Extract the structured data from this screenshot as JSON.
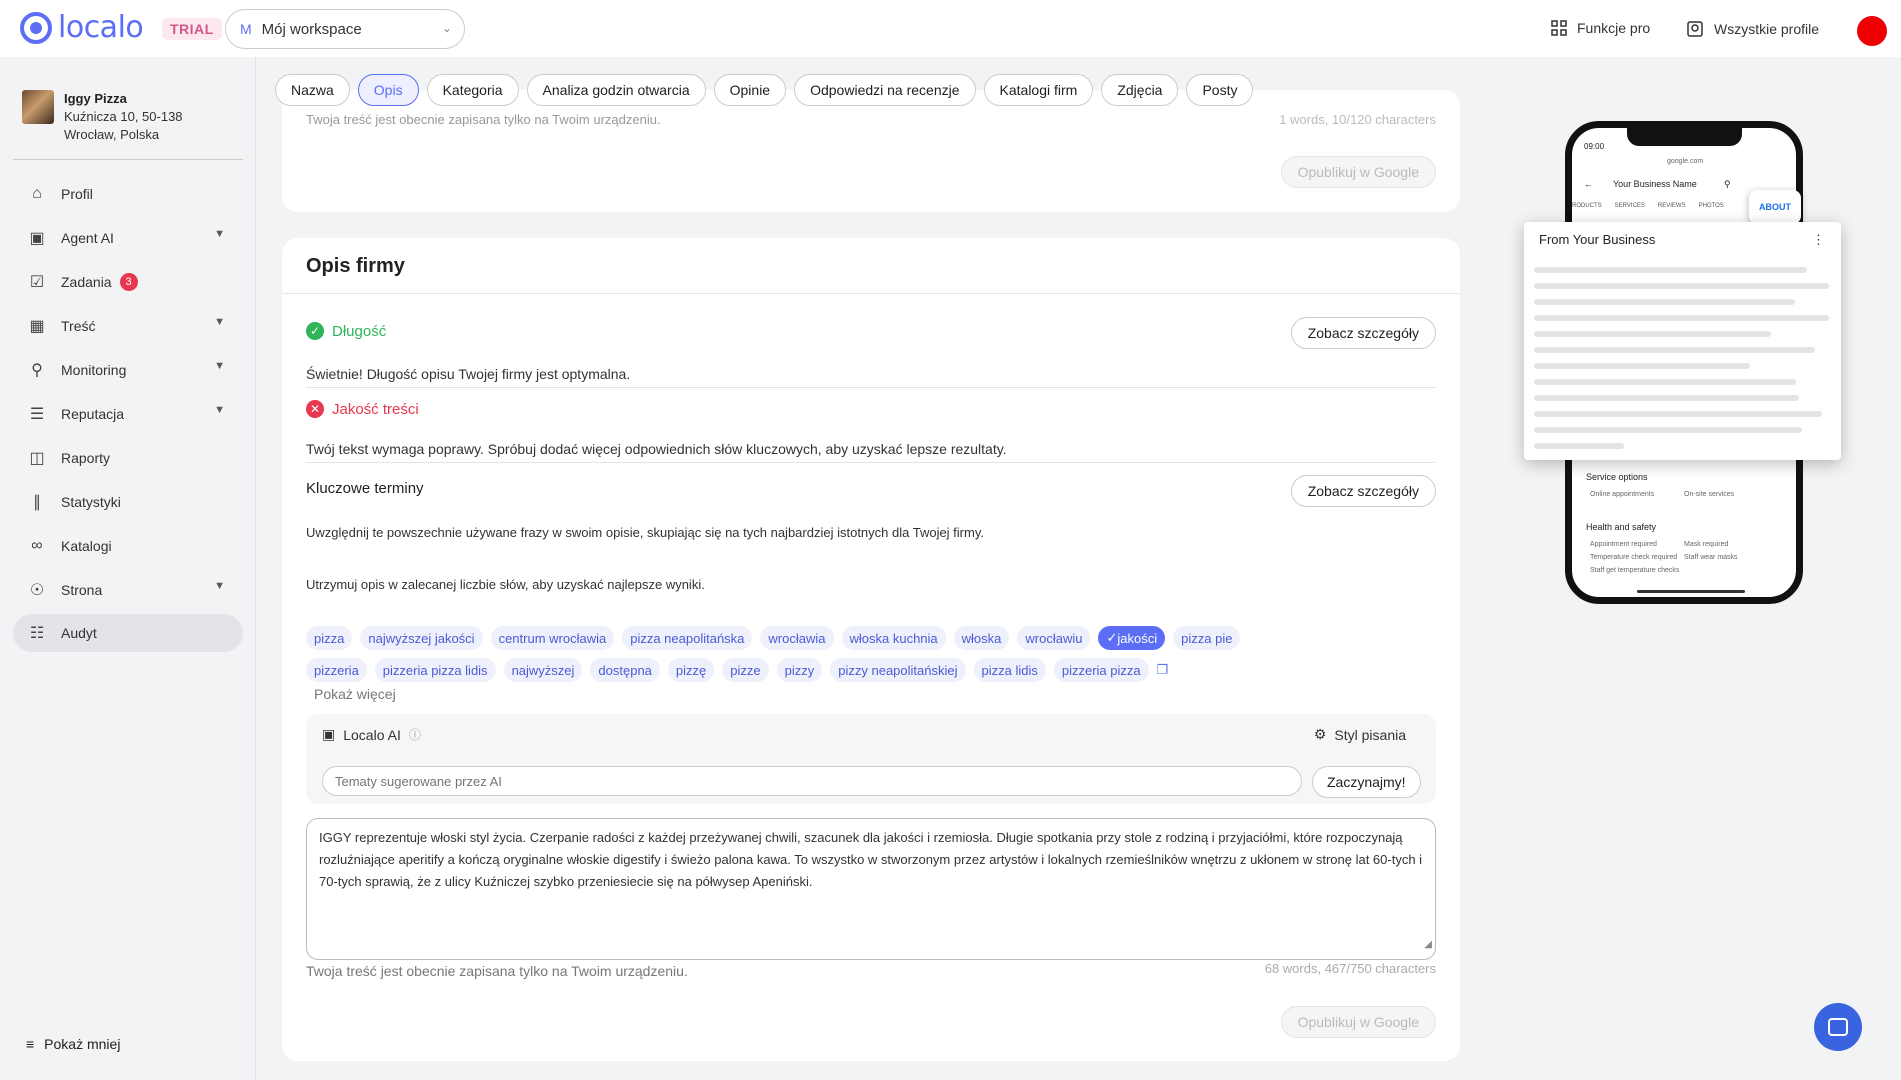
{
  "header": {
    "logo_text": "localo",
    "trial_badge": "TRIAL",
    "workspace_initial": "M",
    "workspace_name": "Mój workspace",
    "pro_features": "Funkcje pro",
    "all_profiles": "Wszystkie profile"
  },
  "business": {
    "name": "Iggy Pizza",
    "address_line1": "Kuźnicza 10, 50-138",
    "address_line2": "Wrocław, Polska"
  },
  "sidebar": {
    "items": [
      {
        "label": "Profil",
        "icon": "home-icon"
      },
      {
        "label": "Agent AI",
        "icon": "robot-icon",
        "expandable": true
      },
      {
        "label": "Zadania",
        "icon": "checkbox-icon",
        "badge": "3"
      },
      {
        "label": "Treść",
        "icon": "calendar-icon",
        "expandable": true
      },
      {
        "label": "Monitoring",
        "icon": "location-pin-icon",
        "expandable": true
      },
      {
        "label": "Reputacja",
        "icon": "review-icon",
        "expandable": true
      },
      {
        "label": "Raporty",
        "icon": "document-icon"
      },
      {
        "label": "Statystyki",
        "icon": "chart-icon"
      },
      {
        "label": "Katalogi",
        "icon": "link-icon"
      },
      {
        "label": "Strona",
        "icon": "globe-icon",
        "expandable": true
      },
      {
        "label": "Audyt",
        "icon": "audit-icon",
        "active": true
      }
    ],
    "show_less": "Pokaż mniej"
  },
  "tabs": [
    {
      "label": "Nazwa"
    },
    {
      "label": "Opis",
      "active": true
    },
    {
      "label": "Kategoria"
    },
    {
      "label": "Analiza godzin otwarcia"
    },
    {
      "label": "Opinie"
    },
    {
      "label": "Odpowiedzi na recenzje"
    },
    {
      "label": "Katalogi firm"
    },
    {
      "label": "Zdjęcia"
    },
    {
      "label": "Posty"
    }
  ],
  "top_card": {
    "save_note": "Twoja treść jest obecnie zapisana tylko na Twoim urządzeniu.",
    "counter": "1 words, 10/120 characters",
    "publish": "Opublikuj w Google"
  },
  "description_card": {
    "title": "Opis firmy",
    "length_label": "Długość",
    "length_text": "Świetnie! Długość opisu Twojej firmy jest optymalna.",
    "quality_label": "Jakość treści",
    "quality_text": "Twój tekst wymaga poprawy. Spróbuj dodać więcej odpowiednich słów kluczowych, aby uzyskać lepsze rezultaty.",
    "details_button": "Zobacz szczegóły",
    "keywords_label": "Kluczowe terminy",
    "keywords_text1": "Uwzględnij te powszechnie używane frazy w swoim opisie, skupiając się na tych najbardziej istotnych dla Twojej firmy.",
    "keywords_text2": "Utrzymuj opis w zalecanej liczbie słów, aby uzyskać najlepsze wyniki.",
    "chips": [
      "pizza",
      "najwyższej jakości",
      "centrum wrocławia",
      "pizza neapolitańska",
      "wrocławia",
      "włoska kuchnia",
      "włoska",
      "wrocławiu",
      "jakości",
      "pizza pie",
      "pizzeria",
      "pizzeria pizza lidis",
      "najwyższej",
      "dostępna",
      "pizzę",
      "pizze",
      "pizzy",
      "pizzy neapolitańskiej",
      "pizza lidis",
      "pizzeria pizza"
    ],
    "selected_chip": "jakości",
    "show_more": "Pokaż więcej",
    "ai_label": "Localo AI",
    "writing_style": "Styl pisania",
    "ai_placeholder": "Tematy sugerowane przez AI",
    "ai_button": "Zaczynajmy!",
    "body_text": "IGGY reprezentuje włoski styl życia. Czerpanie radości z każdej przeżywanej chwili, szacunek dla jakości i rzemiosła. Długie spotkania przy stole z rodziną i przyjaciółmi, które rozpoczynają rozluźniające aperitify a kończą oryginalne włoskie digestify i świeżo palona kawa. To wszystko w stworzonym przez artystów i lokalnych rzemieślników wnętrzu z ukłonem w stronę lat 60-tych i 70-tych sprawią, że z ulicy Kuźniczej szybko przeniesiecie się na półwysep Apeniński.",
    "save_note": "Twoja treść jest obecnie zapisana tylko na Twoim urządzeniu.",
    "counter": "68 words, 467/750 characters",
    "publish": "Opublikuj w Google"
  },
  "preview": {
    "time": "09:00",
    "url": "google.com",
    "business_name": "Your Business Name",
    "tabs": [
      "RODUCTS",
      "SERVICES",
      "REVIEWS",
      "PHOTOS"
    ],
    "about": "ABOUT",
    "from_business": "From Your Business",
    "service_options": "Service options",
    "online_appointments": "Online appointments",
    "onsite_services": "On-site services",
    "health_safety": "Health and safety",
    "appointment_required": "Appointment required",
    "mask_required": "Mask required",
    "temp_check": "Temperature check required",
    "staff_masks": "Staff wear masks",
    "staff_temp": "Staff get temperature checks"
  },
  "colors": {
    "accent": "#5b6ef5",
    "success": "#2fb45a",
    "error": "#e8384f"
  }
}
